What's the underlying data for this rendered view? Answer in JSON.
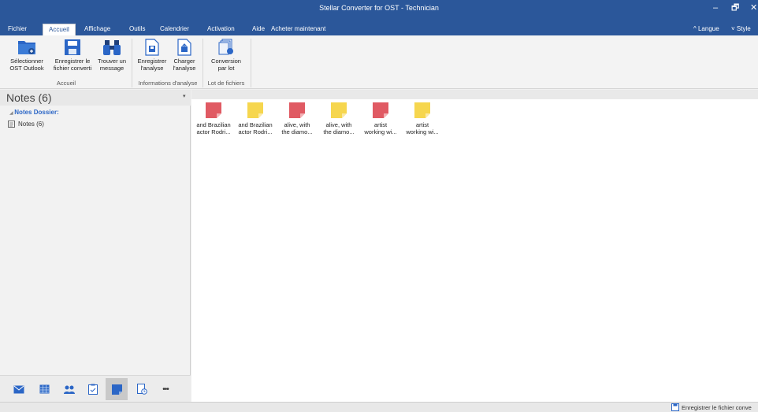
{
  "window": {
    "title": "Stellar Converter for OST - Technician",
    "minimize": "–",
    "maximize": "🗗",
    "close": "✕"
  },
  "menu": {
    "items": [
      "Fichier",
      "Accueil",
      "Affichage",
      "Outils",
      "Calendrier",
      "Activation",
      "Aide",
      "Acheter maintenant"
    ],
    "active": "Accueil",
    "langue": "^ Langue",
    "style": "˅ Style"
  },
  "ribbon": {
    "buttons": [
      {
        "label": "Sélectionner\nOST Outlook",
        "icon": "folder-icon"
      },
      {
        "label": "Enregistrer le\nfichier converti",
        "icon": "save-icon"
      },
      {
        "label": "Trouver un\nmessage",
        "icon": "binoculars-icon"
      },
      {
        "label": "Enregistrer\nl'analyse",
        "icon": "save-scan-icon"
      },
      {
        "label": "Charger\nl'analyse",
        "icon": "load-scan-icon"
      },
      {
        "label": "Conversion\npar lot",
        "icon": "batch-convert-icon"
      }
    ],
    "groups": [
      "Accueil",
      "Informations d'analyse",
      "Lot de fichiers"
    ]
  },
  "left_pane": {
    "title": "Notes (6)",
    "pin": "▾",
    "tree": {
      "root": "Notes Dossier:",
      "child": "Notes (6)"
    },
    "nav_icons": [
      "mail-icon",
      "calendar-icon",
      "contacts-icon",
      "tasks-icon",
      "notes-icon",
      "journal-icon",
      "more-icon"
    ],
    "more_label": "•••"
  },
  "notes": [
    {
      "caption": "and Brazilian\nactor Rodri...",
      "color": "#e05a63"
    },
    {
      "caption": "and Brazilian\nactor Rodri...",
      "color": "#f6d64e"
    },
    {
      "caption": "alive, with\nthe diamo...",
      "color": "#e05a63"
    },
    {
      "caption": "alive, with\nthe diamo...",
      "color": "#f6d64e"
    },
    {
      "caption": "artist\nworking wi...",
      "color": "#e05a63"
    },
    {
      "caption": "artist\nworking wi...",
      "color": "#f6d64e"
    }
  ],
  "status_bar": {
    "save_label": "Enregistrer le fichier conve"
  },
  "colors": {
    "brand": "#2b579a",
    "accent_blue": "#2b66c6",
    "note_red": "#e05a63",
    "note_yellow": "#f6d64e"
  }
}
